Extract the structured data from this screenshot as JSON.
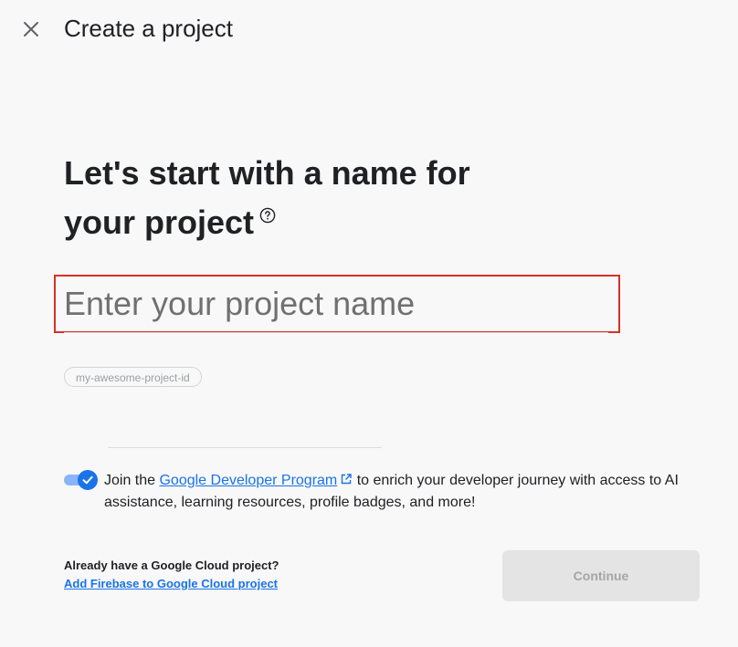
{
  "header": {
    "title": "Create a project",
    "close_icon": "close-icon"
  },
  "main": {
    "heading_line1": "Let's start with a name for",
    "heading_line2": "your project",
    "help_icon": "help-circle-icon",
    "project_name": {
      "value": "",
      "placeholder": "Enter your project name"
    },
    "project_id": "my-awesome-project-id",
    "developer_program": {
      "toggle_on": true,
      "text_before": "Join the ",
      "link_text": "Google Developer Program",
      "link_icon": "open-in-new-icon",
      "text_after": " to enrich your developer journey with access to AI assistance, learning resources, profile badges, and more!"
    },
    "google_cloud": {
      "question": "Already have a Google Cloud project?",
      "link_text": "Add Firebase to Google Cloud project"
    },
    "continue_label": "Continue",
    "continue_enabled": false
  },
  "colors": {
    "background": "#f8f8f8",
    "accent": "#1a73e8",
    "highlight_border": "#d93025",
    "disabled_button_bg": "#e4e4e4",
    "disabled_button_text": "#a6a6a6"
  }
}
